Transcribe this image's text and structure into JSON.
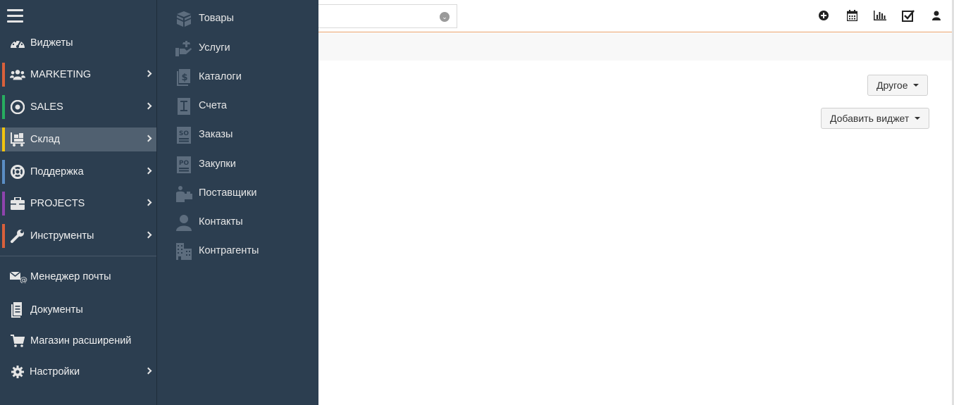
{
  "sidebar": {
    "items": [
      {
        "label": "Виджеты",
        "icon": "dashboard-icon",
        "stripe": "",
        "arrow": false
      },
      {
        "label": "MARKETING",
        "icon": "users-icon",
        "stripe": "#d9603b",
        "arrow": true
      },
      {
        "label": "SALES",
        "icon": "target-icon",
        "stripe": "#27ae60",
        "arrow": true
      },
      {
        "label": "Склад",
        "icon": "warehouse-cart-icon",
        "stripe": "#f1c40f",
        "arrow": true,
        "active": true
      },
      {
        "label": "Поддержка",
        "icon": "lifebuoy-icon",
        "stripe": "#5b8ec4",
        "arrow": true
      },
      {
        "label": "PROJECTS",
        "icon": "briefcase-icon",
        "stripe": "#8e44ad",
        "arrow": true
      },
      {
        "label": "Инструменты",
        "icon": "wrench-icon",
        "stripe": "#d9603b",
        "arrow": true
      },
      {
        "label": "Менеджер почты",
        "icon": "mail-at-icon",
        "stripe": "",
        "arrow": false
      },
      {
        "label": "Документы",
        "icon": "document-icon",
        "stripe": "",
        "arrow": false
      },
      {
        "label": "Магазин расширений",
        "icon": "cart-icon",
        "stripe": "",
        "arrow": false
      },
      {
        "label": "Настройки",
        "icon": "gear-icon",
        "stripe": "",
        "arrow": true
      }
    ]
  },
  "submenu": {
    "items": [
      {
        "label": "Товары",
        "icon": "boxes-icon"
      },
      {
        "label": "Услуги",
        "icon": "service-hand-icon"
      },
      {
        "label": "Каталоги",
        "icon": "catalog-dollar-icon"
      },
      {
        "label": "Счета",
        "icon": "invoice-icon"
      },
      {
        "label": "Заказы",
        "icon": "sales-order-icon"
      },
      {
        "label": "Закупки",
        "icon": "purchase-order-icon"
      },
      {
        "label": "Поставщики",
        "icon": "vendor-icon"
      },
      {
        "label": "Контакты",
        "icon": "contact-person-icon"
      },
      {
        "label": "Контрагенты",
        "icon": "buildings-icon"
      }
    ]
  },
  "header": {
    "icons": [
      "plus-circle-icon",
      "calendar-icon",
      "bar-chart-icon",
      "checkbox-icon",
      "user-icon"
    ]
  },
  "main": {
    "other_button": "Другое",
    "add_widget_button": "Добавить виджет"
  },
  "colors": {
    "sidebar_bg": "#2c3e50",
    "active_item_bg": "#506070",
    "header_accent": "#e8a06a"
  }
}
